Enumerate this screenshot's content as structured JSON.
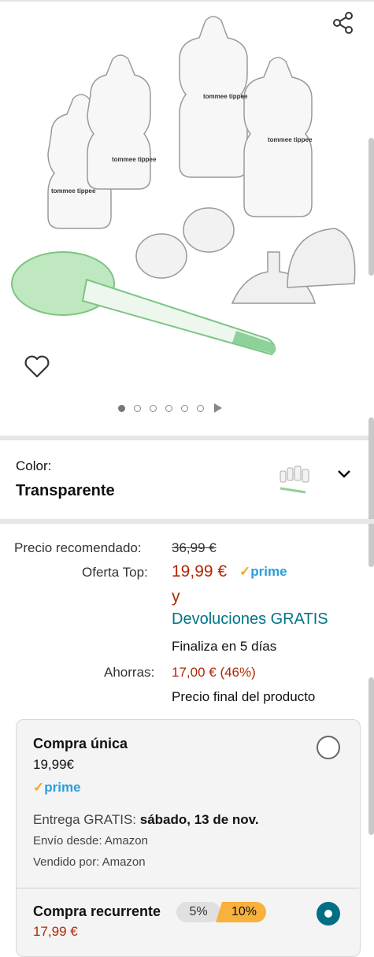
{
  "product": {
    "image_alt": "Tommee Tippee",
    "carousel": {
      "count": 6,
      "active": 0
    }
  },
  "color": {
    "label": "Color:",
    "value": "Transparente",
    "thumbnail_icon": "product-thumbnail",
    "dropdown_icon": "chevron-down-icon"
  },
  "pricing": {
    "rec_label": "Precio recomendado:",
    "rec_value": "36,99 €",
    "offer_label": "Oferta Top:",
    "offer_value": "19,99 €",
    "prime_check": "✓",
    "prime_text": "prime",
    "and_text": "y",
    "returns_text": "Devoluciones GRATIS",
    "ends_text": "Finaliza en 5 días",
    "save_label": "Ahorras:",
    "save_value": "17,00 € (46%)",
    "final_text": "Precio final del producto"
  },
  "purchase": {
    "one_time": {
      "title": "Compra única",
      "price": "19,99€",
      "prime_check": "✓",
      "prime_text": "prime",
      "delivery_prefix": "Entrega GRATIS: ",
      "delivery_date": "sábado, 13 de nov.",
      "ship_from": "Envío desde: Amazon",
      "sold_by": "Vendido por: Amazon"
    },
    "recurring": {
      "title": "Compra recurrente",
      "badge_low": "5%",
      "badge_high": "10%",
      "price": "17,99 €"
    }
  },
  "colors": {
    "accent_red": "#b12704",
    "link_teal": "#00748a",
    "prime_blue": "#2a9fd6",
    "badge_orange": "#f7b13c"
  }
}
